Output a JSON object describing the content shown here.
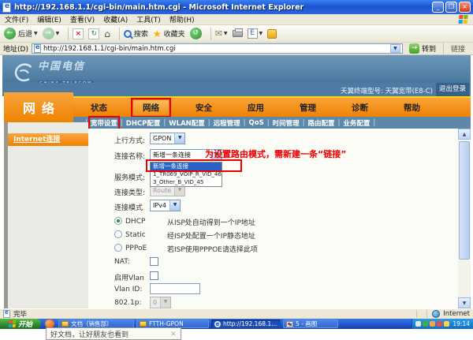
{
  "titlebar": {
    "title": "http://192.168.1.1/cgi-bin/main.htm.cgi - Microsoft Internet Explorer"
  },
  "menubar": {
    "items": [
      "文件(F)",
      "编辑(E)",
      "查看(V)",
      "收藏(A)",
      "工具(T)",
      "帮助(H)"
    ]
  },
  "toolbar": {
    "back": "后退",
    "search": "搜索",
    "favorites": "收藏夹"
  },
  "addressbar": {
    "label": "地址(D)",
    "url": "http://192.168.1.1/cgi-bin/main.htm.cgi",
    "go": "转到",
    "links": "链接"
  },
  "page": {
    "brand": {
      "name": "中国电信",
      "sub": "CHINA TELECOM"
    },
    "device_info": "天翼终端型号: 天翼宽带(E8-C)",
    "logout": "退出登录",
    "section": "网络",
    "separator": "|",
    "tabs": [
      {
        "label": "状态"
      },
      {
        "label": "网络"
      },
      {
        "label": "安全"
      },
      {
        "label": "应用"
      },
      {
        "label": "管理"
      },
      {
        "label": "诊断"
      },
      {
        "label": "帮助"
      }
    ],
    "subnav": [
      "宽带设置",
      "DHCP配置",
      "WLAN配置",
      "远程管理",
      "QoS",
      "时间管理",
      "路由配置",
      "业务配置"
    ],
    "sidebar": {
      "item": "Internet连接"
    },
    "annotation": "为设置路由模式，需新建一条“链接”",
    "form": {
      "uplink": {
        "label": "上行方式:",
        "value": "GPON"
      },
      "conn_name": {
        "label": "连接名称:",
        "value": "新增一条连接",
        "options": [
          "新增一条连接",
          "1_TR069_VOIP_R_VID_46",
          "3_Other_B_VID_45"
        ]
      },
      "service_mode": {
        "label": "服务模式:"
      },
      "conn_type": {
        "label": "连接类型:",
        "value": "Route"
      },
      "conn_mode": {
        "label": "连接模式",
        "value": "IPv4"
      },
      "dhcp": {
        "label": "DHCP",
        "desc": "从ISP处自动得到一个IP地址"
      },
      "static": {
        "label": "Static",
        "desc": "经ISP处配置一个IP静态地址"
      },
      "pppoe": {
        "label": "PPPoE",
        "desc": "若ISP使用PPPOE请选择此项"
      },
      "nat": {
        "label": "NAT:"
      },
      "vlan_enable": {
        "label": "启用Vlan"
      },
      "vlan_id": {
        "label": "Vlan ID:"
      },
      "dot1p": {
        "label": "802.1p:",
        "value": "0"
      }
    },
    "dropdown_glyph": "▼",
    "scroll_up": "▲",
    "scroll_down": "▼"
  },
  "statusbar": {
    "status": "完毕",
    "zone": "Internet"
  },
  "taskbar": {
    "start": "开始",
    "items": [
      {
        "label": "文档（销售部）"
      },
      {
        "label": "FTTH-GPON"
      },
      {
        "label": "http://192.168.1..."
      },
      {
        "label": "5 - 画图"
      }
    ],
    "time": "19:14"
  },
  "popup": {
    "text": "好文档，让好朋友也看到",
    "close": "×"
  },
  "colors": {
    "accent_orange": "#f08a00",
    "band_blue": "#4e7ba3",
    "highlight_red": "#e80000",
    "selection_blue": "#2a63c8"
  }
}
